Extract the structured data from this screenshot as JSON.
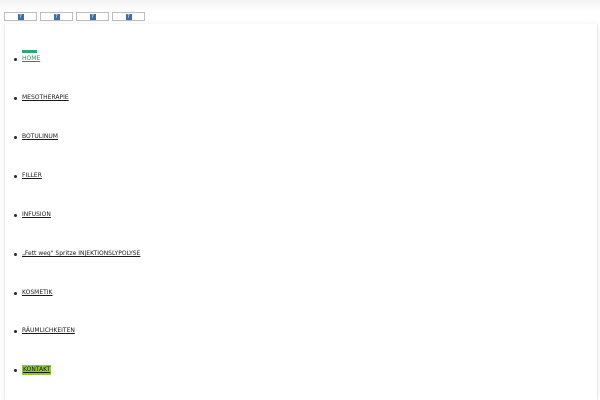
{
  "language_flags": [
    {
      "icon": "flag-icon",
      "glyph": "?"
    },
    {
      "icon": "flag-icon",
      "glyph": "?"
    },
    {
      "icon": "flag-icon",
      "glyph": "?"
    },
    {
      "icon": "flag-icon",
      "glyph": "?"
    }
  ],
  "menu": {
    "items": [
      {
        "label": "HOME",
        "state": "active"
      },
      {
        "label": "MESOTHERAPIE",
        "state": "normal"
      },
      {
        "label": "BOTULINUM",
        "state": "normal"
      },
      {
        "label": "FILLER",
        "state": "normal"
      },
      {
        "label": "INFUSION",
        "state": "normal"
      },
      {
        "label": "„Fett weg\" Spritze INJEKTIONSLYPOLYSE",
        "state": "normal"
      },
      {
        "label": "KOSMETIK",
        "state": "normal"
      },
      {
        "label": "RÄUMLICHKEITEN",
        "state": "normal"
      },
      {
        "label": "KONTAKT",
        "state": "highlighted"
      }
    ]
  },
  "colors": {
    "active_accent": "#2ea777",
    "highlight_bg": "#8fc63f",
    "flag_icon_bg": "#3a6ea5"
  }
}
